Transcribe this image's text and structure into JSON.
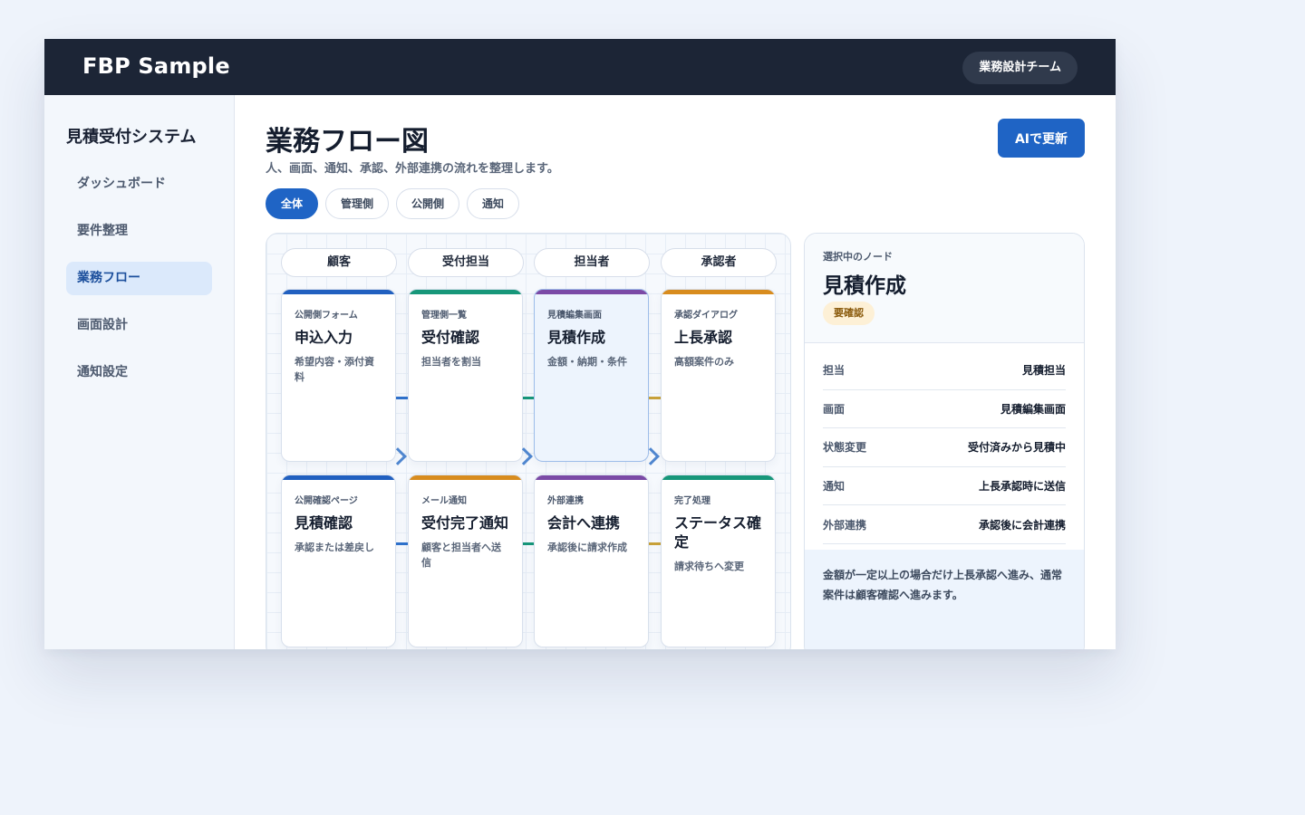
{
  "header": {
    "brand": "FBP Sample",
    "team": "業務設計チーム"
  },
  "sidebar": {
    "system_title": "見積受付システム",
    "items": [
      {
        "label": "ダッシュボード",
        "active": false
      },
      {
        "label": "要件整理",
        "active": false
      },
      {
        "label": "業務フロー",
        "active": true
      },
      {
        "label": "画面設計",
        "active": false
      },
      {
        "label": "通知設定",
        "active": false
      }
    ]
  },
  "main": {
    "title": "業務フロー図",
    "subtitle": "人、画面、通知、承認、外部連携の流れを整理します。",
    "ai_button": "AIで更新",
    "filters": [
      {
        "label": "全体",
        "active": true
      },
      {
        "label": "管理側",
        "active": false
      },
      {
        "label": "公開側",
        "active": false
      },
      {
        "label": "通知",
        "active": false
      }
    ]
  },
  "board": {
    "lanes": [
      "顧客",
      "受付担当",
      "担当者",
      "承認者"
    ],
    "colors": {
      "blue": "#2160c0",
      "green": "#17977a",
      "purple": "#7b4aa6",
      "orange": "#d88c1e"
    },
    "row1": [
      {
        "kicker": "公開側フォーム",
        "title": "申込入力",
        "desc": "希望内容・添付資料",
        "color": "blue"
      },
      {
        "kicker": "管理側一覧",
        "title": "受付確認",
        "desc": "担当者を割当",
        "color": "green"
      },
      {
        "kicker": "見積編集画面",
        "title": "見積作成",
        "desc": "金額・納期・条件",
        "color": "purple",
        "selected": true
      },
      {
        "kicker": "承認ダイアログ",
        "title": "上長承認",
        "desc": "高額案件のみ",
        "color": "orange"
      }
    ],
    "row2": [
      {
        "kicker": "公開確認ページ",
        "title": "見積確認",
        "desc": "承認または差戻し",
        "color": "blue"
      },
      {
        "kicker": "メール通知",
        "title": "受付完了通知",
        "desc": "顧客と担当者へ送信",
        "color": "orange"
      },
      {
        "kicker": "外部連携",
        "title": "会計へ連携",
        "desc": "承認後に請求作成",
        "color": "purple"
      },
      {
        "kicker": "完了処理",
        "title": "ステータス確定",
        "desc": "請求待ちへ変更",
        "color": "green"
      }
    ]
  },
  "panel": {
    "kicker": "選択中のノード",
    "title": "見積作成",
    "badge": "要確認",
    "rows": [
      {
        "key": "担当",
        "value": "見積担当"
      },
      {
        "key": "画面",
        "value": "見積編集画面"
      },
      {
        "key": "状態変更",
        "value": "受付済みから見積中"
      },
      {
        "key": "通知",
        "value": "上長承認時に送信"
      },
      {
        "key": "外部連携",
        "value": "承認後に会計連携"
      }
    ],
    "note": "金額が一定以上の場合だけ上長承認へ進み、通常案件は顧客確認へ進みます。"
  }
}
